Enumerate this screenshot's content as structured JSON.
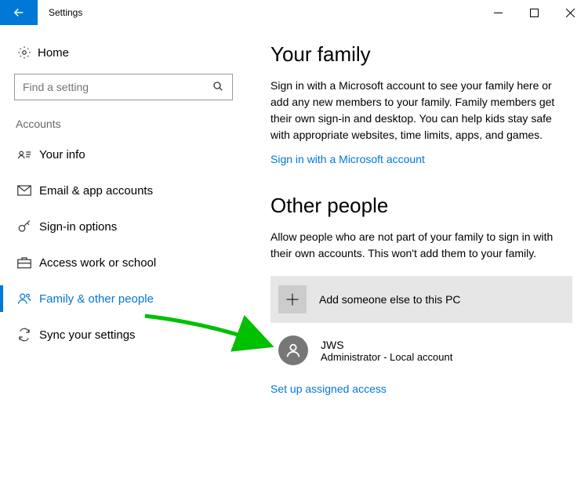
{
  "window": {
    "title": "Settings"
  },
  "sidebar": {
    "home": "Home",
    "search_placeholder": "Find a setting",
    "section": "Accounts",
    "items": [
      {
        "label": "Your info"
      },
      {
        "label": "Email & app accounts"
      },
      {
        "label": "Sign-in options"
      },
      {
        "label": "Access work or school"
      },
      {
        "label": "Family & other people"
      },
      {
        "label": "Sync your settings"
      }
    ]
  },
  "main": {
    "family": {
      "heading": "Your family",
      "body": "Sign in with a Microsoft account to see your family here or add any new members to your family. Family members get their own sign-in and desktop. You can help kids stay safe with appropriate websites, time limits, apps, and games.",
      "signin_link": "Sign in with a Microsoft account"
    },
    "other": {
      "heading": "Other people",
      "body": "Allow people who are not part of your family to sign in with their own accounts. This won't add them to your family.",
      "add_label": "Add someone else to this PC",
      "user": {
        "name": "JWS",
        "role": "Administrator - Local account"
      },
      "assigned_link": "Set up assigned access"
    }
  }
}
